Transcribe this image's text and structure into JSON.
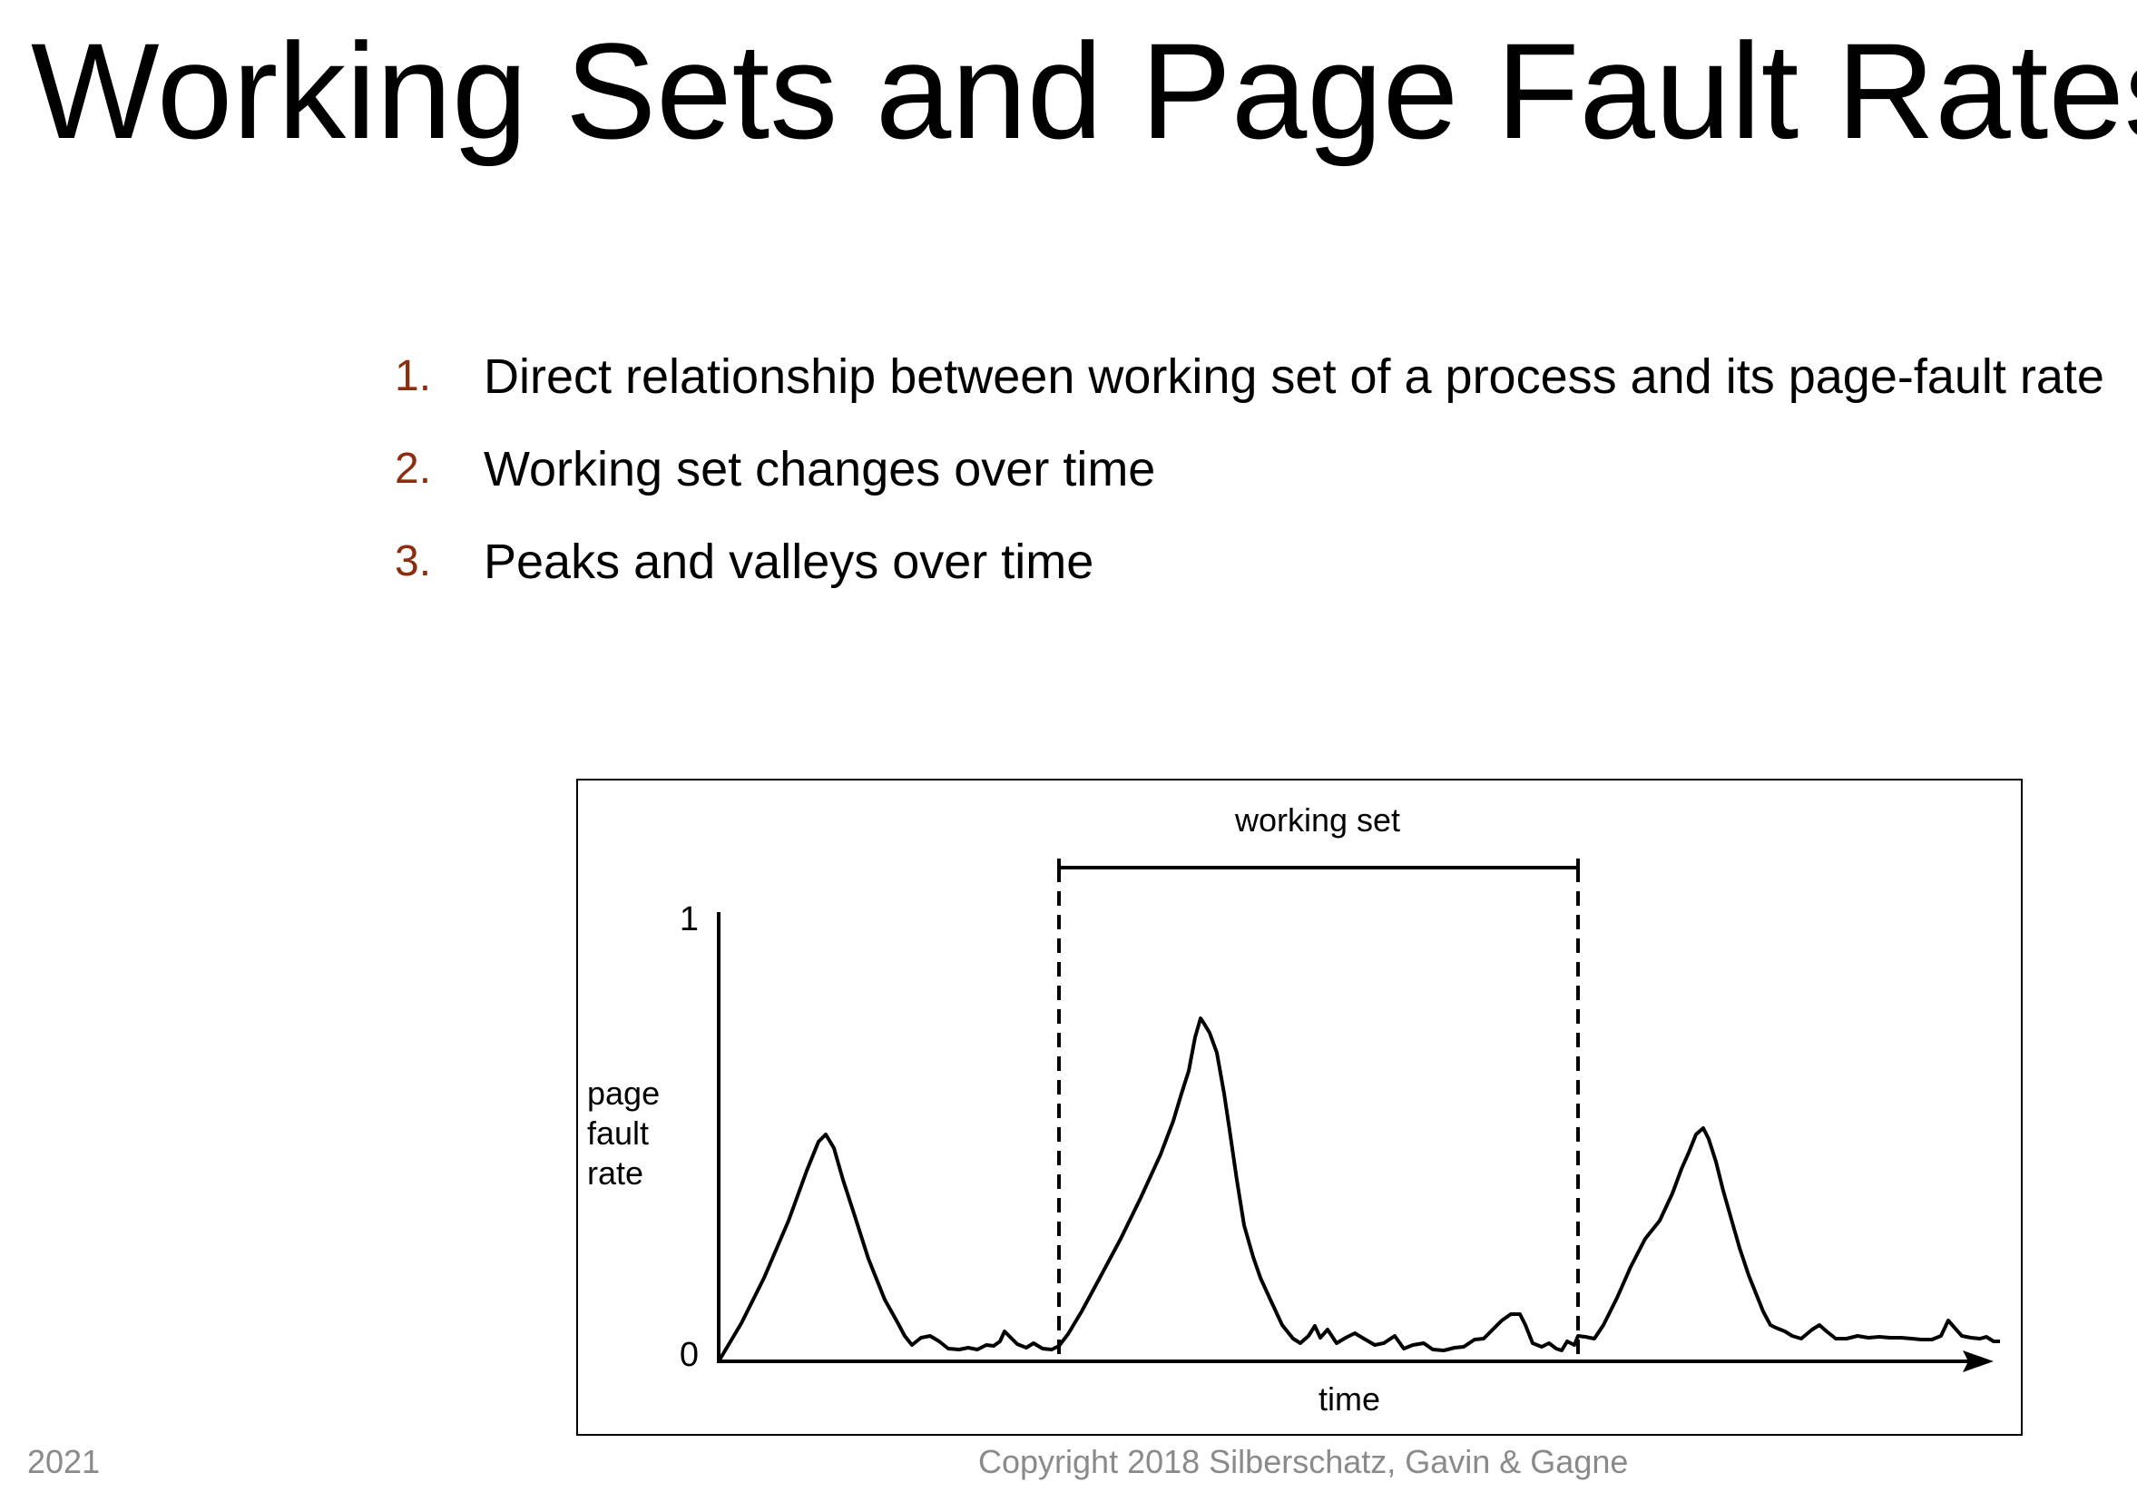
{
  "slide": {
    "title": "Working Sets and Page Fault Rates",
    "bullets": [
      {
        "num": "1.",
        "text": "Direct relationship between working set of a process and its page-fault rate"
      },
      {
        "num": "2.",
        "text": "Working set changes over time"
      },
      {
        "num": "3.",
        "text": "Peaks and valleys over time"
      }
    ],
    "footer_left": "2021",
    "footer_center": "Copyright 2018 Silberschatz, Gavin & Gagne",
    "accent_color": "#8b2e0f",
    "footer_color": "#8a8a8a"
  },
  "figure": {
    "working_set_label": "working set",
    "y_top_label": "1",
    "y_bottom_label": "0",
    "y_axis_label": [
      "page",
      "fault",
      "rate"
    ],
    "x_axis_label": "time"
  }
}
